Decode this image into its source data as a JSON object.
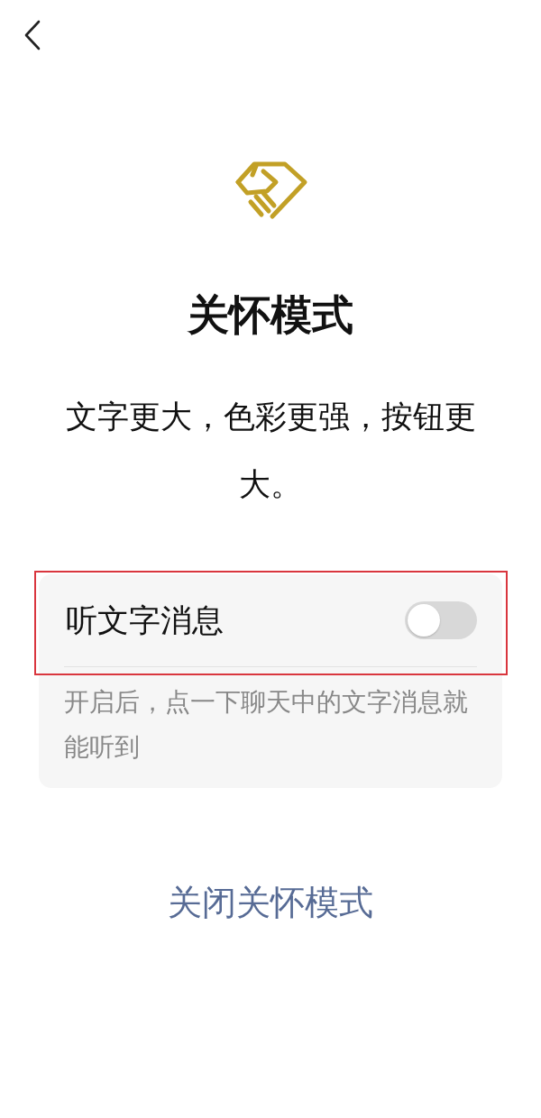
{
  "title": "关怀模式",
  "description": "文字更大，色彩更强，按钮更大。",
  "setting": {
    "label": "听文字消息",
    "on": false,
    "highlighted": true,
    "hint": "开启后，点一下聊天中的文字消息就能听到"
  },
  "link": "关闭关怀模式"
}
